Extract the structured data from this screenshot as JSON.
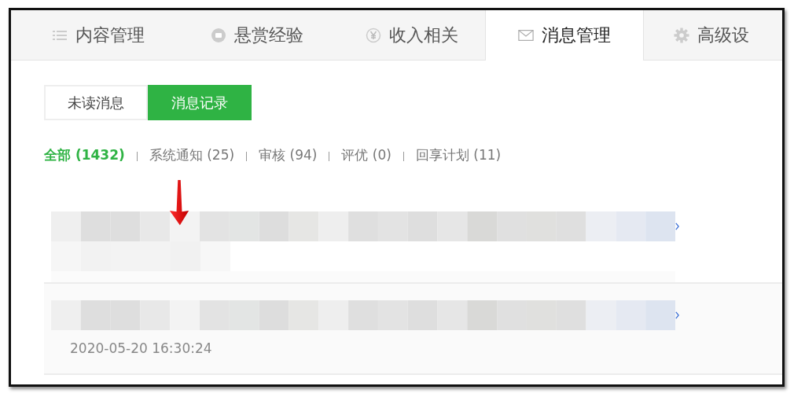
{
  "tabs": [
    {
      "label": "内容管理",
      "kind": "list",
      "selected": false
    },
    {
      "label": "悬赏经验",
      "kind": "coin",
      "selected": false
    },
    {
      "label": "收入相关",
      "kind": "yen",
      "selected": false
    },
    {
      "label": "消息管理",
      "kind": "mail",
      "selected": true
    },
    {
      "label": "高级设",
      "kind": "gear",
      "selected": false
    }
  ],
  "subtabs": [
    {
      "label": "未读消息",
      "selected": false
    },
    {
      "label": "消息记录",
      "selected": true
    }
  ],
  "filters": [
    {
      "label": "全部 (1432)",
      "selected": true
    },
    {
      "label": "系统通知 (25)",
      "selected": false
    },
    {
      "label": "审核 (94)",
      "selected": false
    },
    {
      "label": "评优 (0)",
      "selected": false
    },
    {
      "label": "回享计划 (11)",
      "selected": false
    }
  ],
  "messages": [
    {
      "kind": "long"
    },
    {
      "kind": "dated",
      "time": "2020-05-20 16:30:24"
    }
  ]
}
